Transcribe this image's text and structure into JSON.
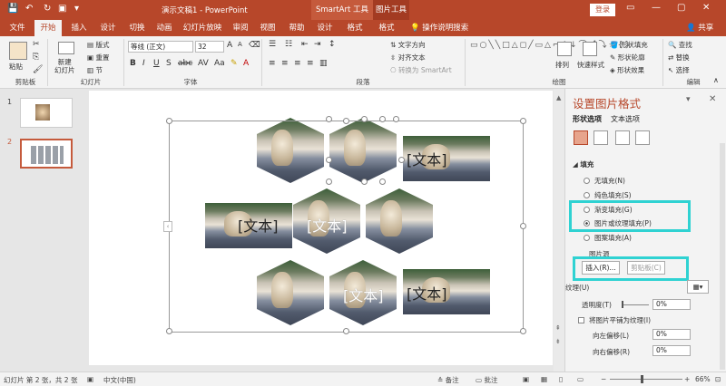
{
  "window": {
    "title": "演示文稿1 - PowerPoint",
    "context_tab_smartart": "SmartArt 工具",
    "context_tab_picture": "图片工具",
    "login": "登录"
  },
  "tabs": [
    "文件",
    "开始",
    "插入",
    "设计",
    "切换",
    "动画",
    "幻灯片放映",
    "审阅",
    "视图",
    "帮助",
    "设计",
    "格式",
    "格式"
  ],
  "tell_me": "操作说明搜索",
  "share": "共享",
  "ribbon": {
    "paste": "粘贴",
    "clipboard": "剪贴板",
    "new_slide": "新建\n幻灯片",
    "layout": "版式",
    "reset": "重置",
    "section": "节",
    "slides_group": "幻灯片",
    "font_name": "等线 (正文)",
    "font_size": "32",
    "font_group": "字体",
    "text_direction": "文字方向",
    "align_text": "对齐文本",
    "convert_smartart": "转换为 SmartArt",
    "paragraph_group": "段落",
    "arrange": "排列",
    "quick_styles": "快速样式",
    "shape_fill": "形状填充",
    "shape_outline": "形状轮廓",
    "shape_effects": "形状效果",
    "drawing_group": "绘图",
    "find": "查找",
    "replace": "替换",
    "select": "选择",
    "editing_group": "编辑"
  },
  "thumbnails": [
    "1",
    "2"
  ],
  "slide": {
    "placeholders": [
      "[文本]",
      "[文本]",
      "[文本]",
      "[文本]",
      "[文本]"
    ]
  },
  "pane": {
    "title": "设置图片格式",
    "tab_shape": "形状选项",
    "tab_text": "文本选项",
    "section_fill": "填充",
    "options": [
      "无填充(N)",
      "纯色填充(S)",
      "渐变填充(G)",
      "图片或纹理填充(P)",
      "图案填充(A)"
    ],
    "selected_option": "图片或纹理填充(P)",
    "picture_source": "图片源",
    "insert_btn": "插入(R)...",
    "clipboard_btn": "剪贴板(C)",
    "texture": "纹理(U)",
    "transparency": "透明度(T)",
    "transparency_value": "0%",
    "tile": "将图片平铺为纹理(I)",
    "offset_left": "向左偏移(L)",
    "offset_left_value": "0%",
    "offset_right": "向右偏移(R)",
    "offset_right_value": "0%"
  },
  "status": {
    "slide_info": "幻灯片 第 2 张，共 2 张",
    "language": "中文(中国)",
    "notes": "备注",
    "comments": "批注",
    "zoom": "66%"
  },
  "colors": {
    "brand": "#b7472a",
    "highlight": "#2fd2d2"
  }
}
